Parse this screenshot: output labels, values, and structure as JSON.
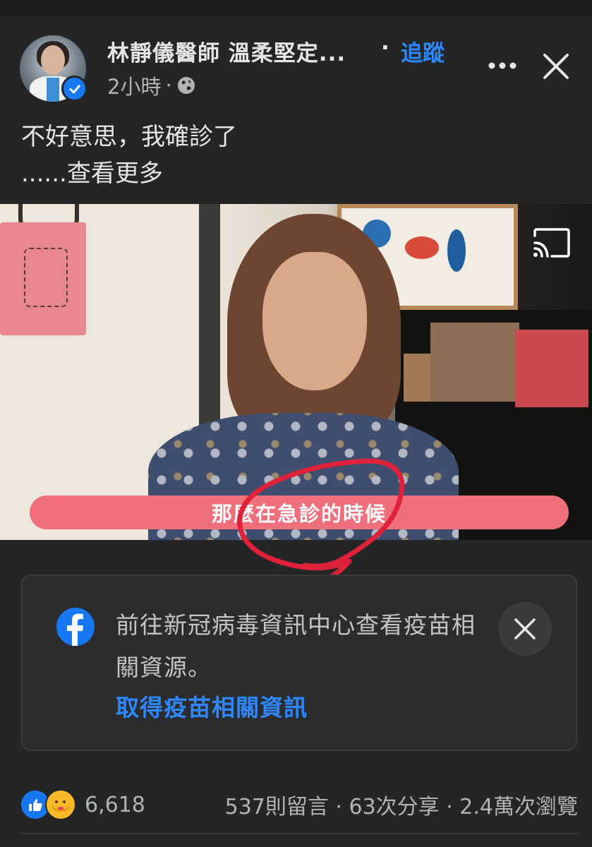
{
  "post": {
    "page_name": "林靜儀醫師 溫柔堅定...",
    "separator": "·",
    "follow_label": "追蹤",
    "time": "2小時",
    "time_sep": "·",
    "privacy_icon": "globe-icon",
    "text_line1": "不好意思，我確診了",
    "see_more": "......查看更多"
  },
  "video": {
    "caption": "那麼在急診的時候",
    "cast_icon": "cast-icon"
  },
  "info_card": {
    "text": "前往新冠病毒資訊中心查看疫苗相關資源。",
    "link": "取得疫苗相關資訊",
    "icon": "facebook-icon"
  },
  "footer": {
    "reaction_count": "6,618",
    "stats": "537則留言 · 63次分享 · 2.4萬次瀏覽"
  },
  "colors": {
    "background": "#242526",
    "accent_blue": "#2d88ff",
    "caption_pink": "#ef6f7c",
    "annotation_red": "#e0213a"
  }
}
